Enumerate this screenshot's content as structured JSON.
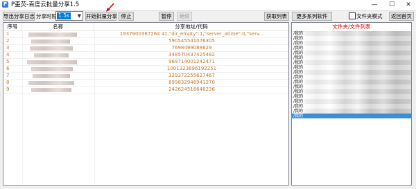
{
  "window": {
    "title": "P歪荧-百度云批量分享1.5",
    "min_glyph": "—",
    "max_glyph": "☐",
    "close_glyph": "✕"
  },
  "toolbar": {
    "export_log": "导出分享日志",
    "interval_label": "分享时隙:",
    "interval_value": "1.5s",
    "start_batch": "开始批量分享",
    "stop": "停止",
    "pause": "暂停",
    "continue": "继续",
    "get_list": "获取列表",
    "more_software": "更多系列软件",
    "folder_mode": "文件夹模式",
    "back_home": "返回首页"
  },
  "table": {
    "headers": [
      "序号",
      "名称",
      "分享地址/代码"
    ],
    "rows": [
      {
        "idx": "1",
        "addr": "1937900367264 41,\"dir_empty\":1,\"server_atime\":0,\"serv..."
      },
      {
        "idx": "2",
        "addr": "590545541076305"
      },
      {
        "idx": "3",
        "addr": "7698499088629"
      },
      {
        "idx": "4",
        "addr": "348570437425482"
      },
      {
        "idx": "5",
        "addr": "969714001242471"
      },
      {
        "idx": "6",
        "addr": "1001323896192251"
      },
      {
        "idx": "7",
        "addr": "329372255627467"
      },
      {
        "idx": "8",
        "addr": "899832946941270"
      },
      {
        "idx": "9",
        "addr": "242624516648236"
      }
    ]
  },
  "folders": {
    "header": "文件夹/文件列表",
    "items": [
      "/我的",
      "/我的",
      "/我的",
      "/我的",
      "/我的",
      "/我的",
      "/我的",
      "/我的",
      "/我的",
      "/我的",
      "/我的",
      "/我的",
      "/我的",
      "/我的",
      "/我的",
      "/我的",
      "/我的",
      "/我的"
    ],
    "selected_index": 17
  },
  "colors": {
    "accent_red": "#d00000",
    "row_text": "#c0782a",
    "selected_bg": "#3a8fd6"
  }
}
